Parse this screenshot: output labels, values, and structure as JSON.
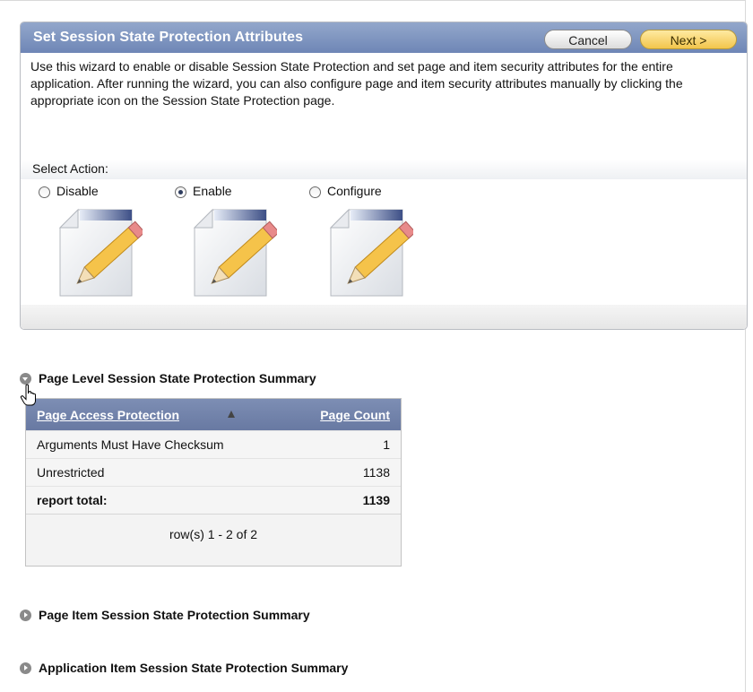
{
  "wizard": {
    "title": "Set Session State Protection Attributes",
    "cancel_label": "Cancel",
    "next_label": "Next >",
    "intro": "Use this wizard to enable or disable Session State Protection and set page and item security attributes for the entire application. After running the wizard, you can also configure page and item security attributes manually by clicking the appropriate icon on the Session State Protection page.",
    "select_label": "Select Action:",
    "options": [
      {
        "label": "Disable",
        "checked": false,
        "icon": "edit-document-icon"
      },
      {
        "label": "Enable",
        "checked": true,
        "icon": "edit-document-icon"
      },
      {
        "label": "Configure",
        "checked": false,
        "icon": "edit-document-icon"
      }
    ]
  },
  "page_level_summary": {
    "title": "Page Level Session State Protection Summary",
    "expanded": true,
    "columns": [
      "Page Access Protection",
      "Page Count"
    ],
    "rows": [
      {
        "protection": "Arguments Must Have Checksum",
        "count": "1"
      },
      {
        "protection": "Unrestricted",
        "count": "1138"
      }
    ],
    "total_label": "report total:",
    "total_value": "1139",
    "pagination": "row(s) 1 - 2 of 2"
  },
  "page_item_summary": {
    "title": "Page Item Session State Protection Summary",
    "expanded": false
  },
  "application_item_summary": {
    "title": "Application Item Session State Protection Summary",
    "expanded": false
  },
  "colors": {
    "header_blue": "#7d8eb4",
    "next_button": "#f2c54c"
  }
}
